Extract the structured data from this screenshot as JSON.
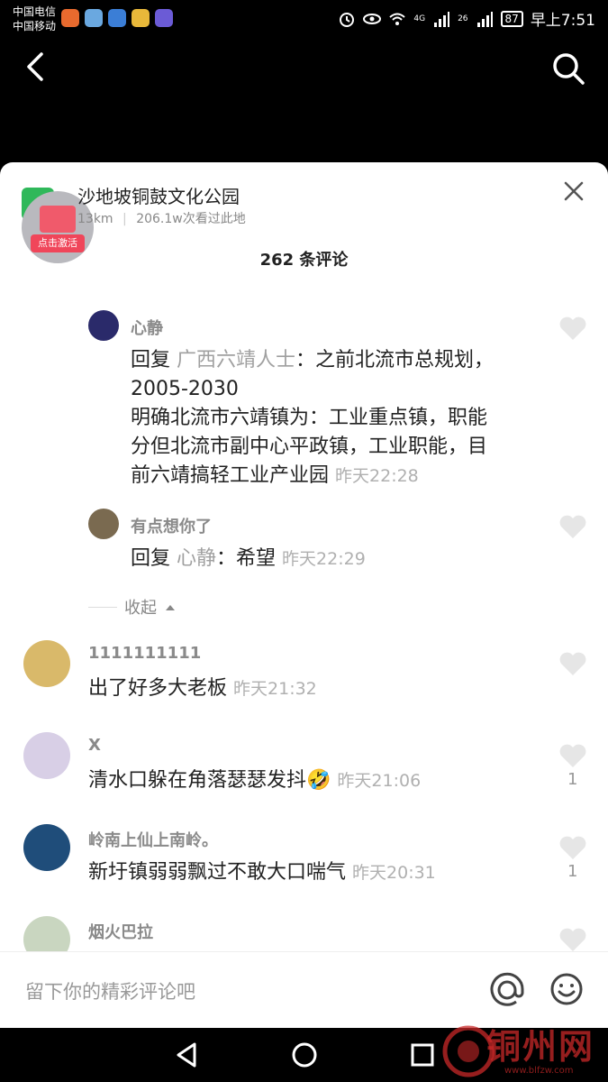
{
  "status_bar": {
    "carrier1": "中国电信",
    "carrier2": "中国移动",
    "battery": "87",
    "signal1": "4G",
    "signal2": "26",
    "time": "早上7:51"
  },
  "location": {
    "title": "沙地坡铜鼓文化公园",
    "distance": "13km",
    "separator": "|",
    "views": "206.1w次看过此地",
    "promo_label": "点击激活"
  },
  "comments_header": {
    "count_title": "262 条评论"
  },
  "replies": [
    {
      "user": "心静",
      "reply_prefix": "回复",
      "reply_to": "广西六靖人士",
      "text": "：之前北流市总规划，2005-2030 明确北流市六靖镇为：工业重点镇，职能分但北流市副中心平政镇，工业职能，目前六靖搞轻工业产业园",
      "line1": "：之前北流市总规划，",
      "line2": "2005-2030",
      "line3": "明确北流市六靖镇为：工业重点镇，职能",
      "line4": "分但北流市副中心平政镇，工业职能，目",
      "line5": "前六靖搞轻工业产业园",
      "time": "昨天22:28"
    },
    {
      "user": "有点想你了",
      "reply_prefix": "回复",
      "reply_to": "心静",
      "text": "：希望",
      "time": "昨天22:29"
    }
  ],
  "collapse_label": "收起",
  "comments": [
    {
      "user": "1111111111",
      "text": "出了好多大老板",
      "time": "昨天21:32",
      "likes": ""
    },
    {
      "user": "X",
      "text": "清水口躲在角落瑟瑟发抖🤣",
      "time": "昨天21:06",
      "likes": "1"
    },
    {
      "user": "岭南上仙上南岭。",
      "text": "新圩镇弱弱飘过不敢大口喘气",
      "time": "昨天20:31",
      "likes": "1"
    },
    {
      "user": "烟火巴拉",
      "text": "",
      "time": "",
      "likes": ""
    }
  ],
  "input": {
    "placeholder": "留下你的精彩评论吧"
  },
  "watermark": {
    "text": "铜州网",
    "url": "www.blfzw.com"
  },
  "colors": {
    "sheet_bg": "#ffffff",
    "meta_gray": "#888888",
    "reply_gray": "#a0a0a0",
    "heart_gray": "#e6e6e6"
  }
}
